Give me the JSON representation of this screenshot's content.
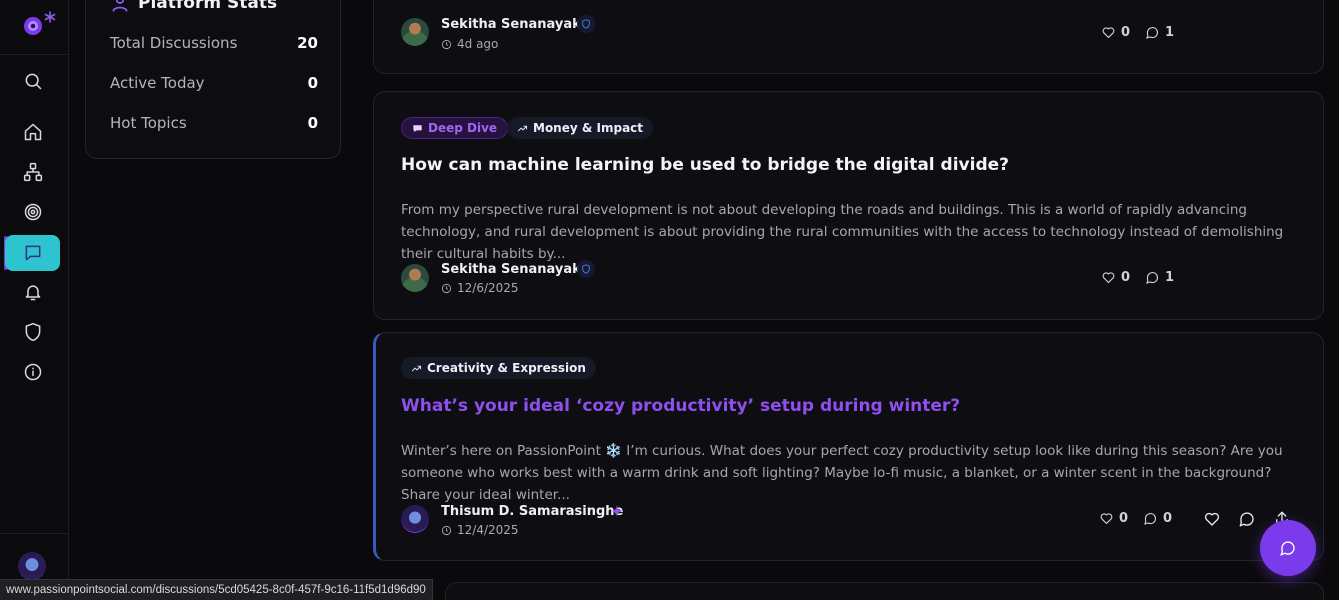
{
  "sidebar": {
    "items": [
      {
        "name": "search",
        "icon": "search-icon"
      },
      {
        "name": "home",
        "icon": "home-icon"
      },
      {
        "name": "network",
        "icon": "network-icon"
      },
      {
        "name": "target",
        "icon": "target-icon"
      },
      {
        "name": "discussions",
        "icon": "chat-icon",
        "active": true
      },
      {
        "name": "notifications",
        "icon": "bell-icon"
      },
      {
        "name": "security",
        "icon": "shield-icon"
      },
      {
        "name": "about",
        "icon": "info-icon"
      }
    ]
  },
  "stats": {
    "title": "Platform Stats",
    "rows": [
      {
        "label": "Total Discussions",
        "value": "20"
      },
      {
        "label": "Active Today",
        "value": "0"
      },
      {
        "label": "Hot Topics",
        "value": "0"
      }
    ]
  },
  "posts": [
    {
      "author": "Sekitha Senanayake",
      "time": "4d ago",
      "likes": "0",
      "comments": "1"
    },
    {
      "tags": [
        "Deep Dive",
        "Money & Impact"
      ],
      "title": "How can machine learning be used to bridge the digital divide?",
      "excerpt": "From my perspective rural development is not about developing the roads and buildings. This is a world of rapidly advancing technology, and rural development is about providing the rural communities with the access to technology instead of demolishing their cultural habits by...",
      "author": "Sekitha Senanayake",
      "time": "12/6/2025",
      "likes": "0",
      "comments": "1"
    },
    {
      "tags": [
        "Creativity & Expression"
      ],
      "title": "What’s your ideal ‘cozy productivity’ setup during winter?",
      "excerpt": "Winter’s here on PassionPoint ❄️ I’m curious. What does your perfect cozy productivity setup look like during this season? Are you someone who works best with a warm drink and soft lighting? Maybe lo-fi music, a blanket, or a winter scent in the background? Share your ideal winter...",
      "author": "Thisum D. Samarasinghe",
      "time": "12/4/2025",
      "likes": "0",
      "comments": "0"
    }
  ],
  "status_bar": {
    "url": "www.passionpointsocial.com/discussions/5cd05425-8c0f-457f-9c16-11f5d1d96d90"
  },
  "colors": {
    "accent": "#7c3aed",
    "active_nav": "#2ec4cf",
    "background": "#0a0a0d"
  }
}
